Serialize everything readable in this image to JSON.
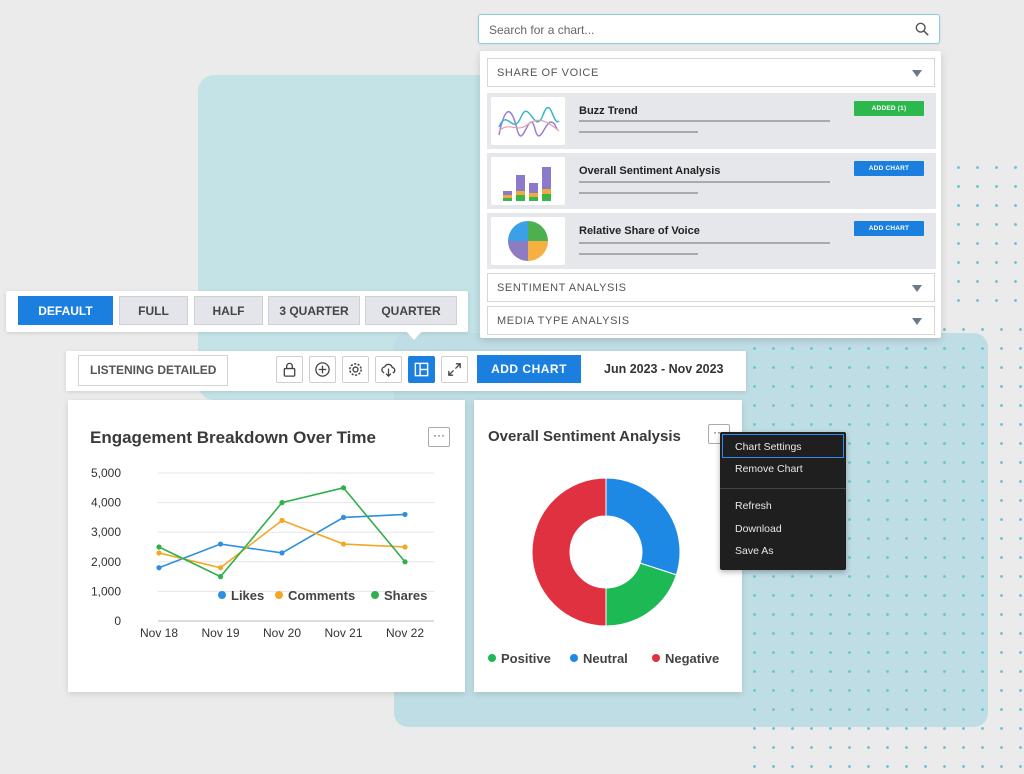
{
  "colors": {
    "accent": "#1b7fe0",
    "added": "#2db84d",
    "likes": "#2e8ee0",
    "comments": "#f5a623",
    "shares": "#2fb04a",
    "positive": "#1db954",
    "neutral": "#1e88e5",
    "negative": "#e03140"
  },
  "search": {
    "placeholder": "Search for a chart..."
  },
  "library": {
    "sections": [
      {
        "title": "SHARE OF VOICE",
        "expanded": true
      },
      {
        "title": "SENTIMENT ANALYSIS",
        "expanded": false
      },
      {
        "title": "MEDIA TYPE ANALYSIS",
        "expanded": false
      }
    ],
    "items": [
      {
        "title": "Buzz Trend",
        "button": "ADDED (1)",
        "thumb_icon": "line-wave-icon"
      },
      {
        "title": "Overall Sentiment Analysis",
        "button": "ADD CHART",
        "thumb_icon": "stacked-bar-icon"
      },
      {
        "title": "Relative Share of Voice",
        "button": "ADD CHART",
        "thumb_icon": "pie-icon"
      }
    ]
  },
  "size_options": {
    "items": [
      "DEFAULT",
      "FULL",
      "HALF",
      "3 QUARTER",
      "QUARTER"
    ],
    "active": "DEFAULT"
  },
  "toolbar": {
    "dashboard_name": "LISTENING DETAILED",
    "tools": [
      "lock-icon",
      "plus-circle-icon",
      "gear-icon",
      "cloud-download-icon",
      "layout-icon",
      "expand-icon"
    ],
    "add_chart": "ADD CHART",
    "date_range": "Jun 2023 - Nov 2023"
  },
  "engagement_card": {
    "title": "Engagement Breakdown Over Time",
    "menu": "···"
  },
  "sentiment_card": {
    "title": "Overall Sentiment Analysis",
    "menu": "···"
  },
  "context_menu": {
    "items": [
      "Chart Settings",
      "Remove Chart",
      "Refresh",
      "Download",
      "Save As"
    ],
    "selected": "Chart Settings"
  },
  "chart_data": [
    {
      "type": "line",
      "title": "Engagement Breakdown Over Time",
      "categories": [
        "Nov 18",
        "Nov 19",
        "Nov 20",
        "Nov 21",
        "Nov 22"
      ],
      "ylim": [
        0,
        5000
      ],
      "yticks": [
        "0",
        "1,000",
        "2,000",
        "3,000",
        "4,000",
        "5,000"
      ],
      "grid": true,
      "legend": "bottom-right",
      "series": [
        {
          "name": "Likes",
          "values": [
            1800,
            2600,
            2300,
            3500,
            3600
          ]
        },
        {
          "name": "Comments",
          "values": [
            2300,
            1800,
            3400,
            2600,
            2500
          ]
        },
        {
          "name": "Shares",
          "values": [
            2500,
            1500,
            4000,
            4500,
            2000
          ]
        }
      ]
    },
    {
      "type": "pie",
      "title": "Overall Sentiment Analysis",
      "donut": true,
      "legend": "bottom",
      "slices": [
        {
          "name": "Positive",
          "value": 20
        },
        {
          "name": "Neutral",
          "value": 30
        },
        {
          "name": "Negative",
          "value": 50
        }
      ]
    }
  ]
}
